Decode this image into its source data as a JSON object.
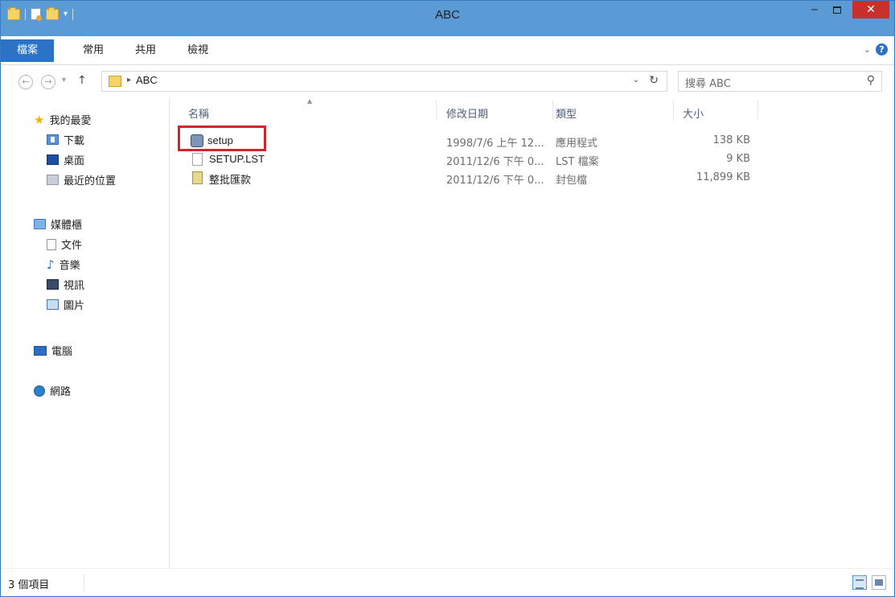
{
  "window": {
    "title": "ABC"
  },
  "ribbon": {
    "tabs": [
      {
        "label": "檔案"
      },
      {
        "label": "常用"
      },
      {
        "label": "共用"
      },
      {
        "label": "檢視"
      }
    ]
  },
  "address": {
    "path": "ABC",
    "search_placeholder": "搜尋 ABC"
  },
  "sidebar": {
    "favorites": {
      "label": "我的最愛",
      "items": [
        {
          "label": "下載"
        },
        {
          "label": "桌面"
        },
        {
          "label": "最近的位置"
        }
      ]
    },
    "libraries": {
      "label": "媒體櫃",
      "items": [
        {
          "label": "文件"
        },
        {
          "label": "音樂"
        },
        {
          "label": "視訊"
        },
        {
          "label": "圖片"
        }
      ]
    },
    "computer": {
      "label": "電腦"
    },
    "network": {
      "label": "網路"
    }
  },
  "file_list": {
    "columns": [
      "名稱",
      "修改日期",
      "類型",
      "大小"
    ],
    "rows": [
      {
        "name": "setup",
        "date": "1998/7/6 上午 12...",
        "type": "應用程式",
        "size": "138 KB",
        "icon": "application-icon"
      },
      {
        "name": "SETUP.LST",
        "date": "2011/12/6 下午 0...",
        "type": "LST 檔案",
        "size": "9 KB",
        "icon": "lst-file-icon"
      },
      {
        "name": "整批匯款",
        "date": "2011/12/6 下午 0...",
        "type": "封包檔",
        "size": "11,899 KB",
        "icon": "cabinet-file-icon"
      }
    ]
  },
  "status": {
    "item_count": "3 個項目"
  },
  "colors": {
    "titlebar": "#5b9bd5",
    "file_tab": "#2a73c6",
    "close": "#c7302b",
    "highlight": "#d0262c"
  }
}
